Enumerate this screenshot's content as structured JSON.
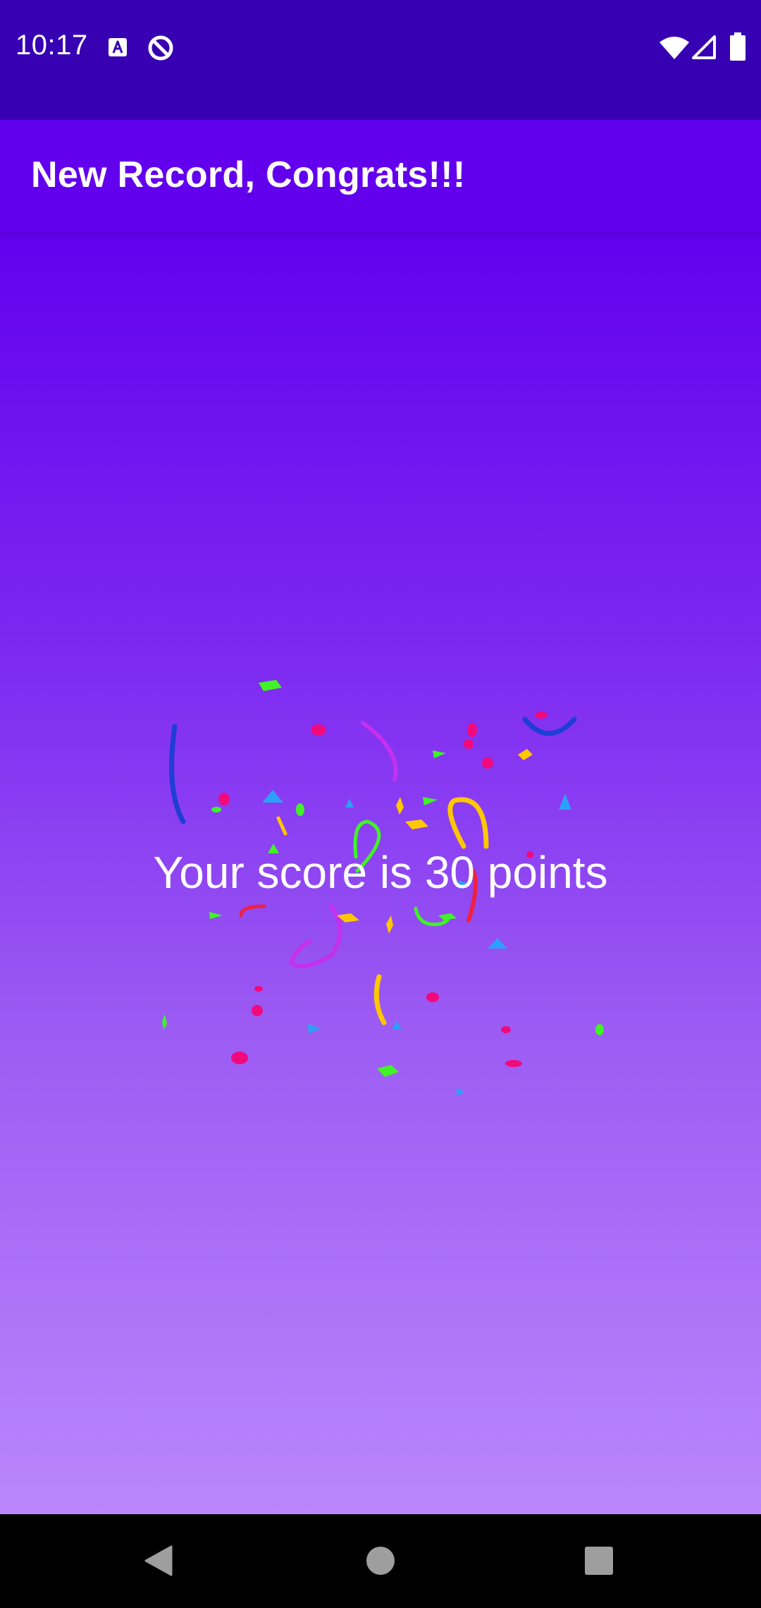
{
  "status_bar": {
    "time": "10:17",
    "background": "#3700B3",
    "left_icons": [
      "font-accessibility-icon",
      "sync-circle-icon"
    ],
    "right_icons": [
      "wifi-icon",
      "cellular-signal-icon",
      "battery-icon"
    ]
  },
  "app_bar": {
    "title": "New Record, Congrats!!!",
    "background": "#6200EE"
  },
  "main": {
    "score_text": "Your score is 30 points",
    "gradient_top": "#6200EE",
    "gradient_bottom": "#BB86FC",
    "confetti_colors": [
      "#F00A7C",
      "#FFC700",
      "#41F227",
      "#2CA0F8",
      "#1E3ED4",
      "#C430F0"
    ]
  },
  "nav_bar": {
    "back_icon": "back-triangle-icon",
    "home_icon": "home-circle-icon",
    "recents_icon": "recents-square-icon"
  }
}
